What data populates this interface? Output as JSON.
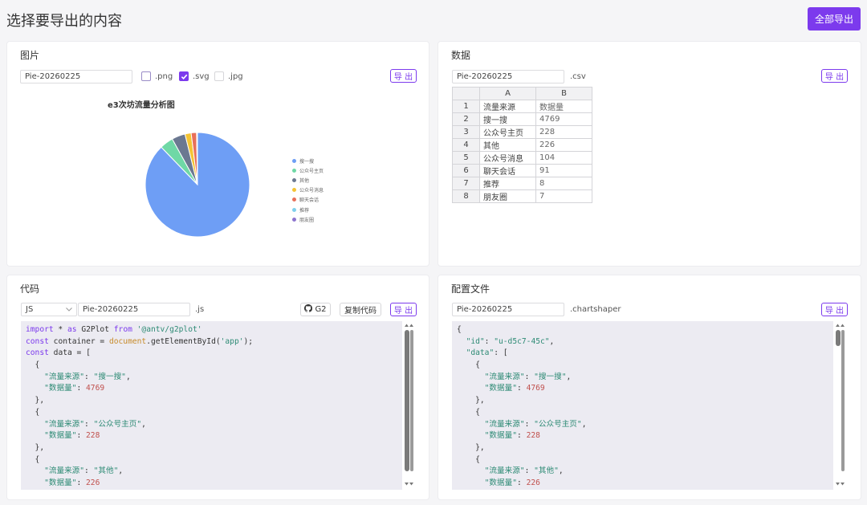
{
  "header": {
    "title": "选择要导出的内容",
    "export_all": "全部导出"
  },
  "image_card": {
    "title": "图片",
    "filename": "Pie-20260225",
    "formats": [
      {
        "label": ".png",
        "checked": false
      },
      {
        "label": ".svg",
        "checked": true
      },
      {
        "label": ".jpg",
        "checked": false
      }
    ],
    "export": "导 出"
  },
  "chart_data": {
    "type": "pie",
    "title": "e3次坊流量分析图",
    "categories": [
      "搜一搜",
      "公众号主页",
      "其他",
      "公众号消息",
      "聊天会话",
      "推荐",
      "朋友圈"
    ],
    "values": [
      4769,
      228,
      226,
      104,
      91,
      8,
      7
    ],
    "colors": [
      "#6e9ef5",
      "#6fd8a6",
      "#6b7891",
      "#f4c434",
      "#e8705a",
      "#7fd0ec",
      "#8d75cf"
    ],
    "legend_position": "right"
  },
  "data_card": {
    "title": "数据",
    "filename": "Pie-20260225",
    "ext": ".csv",
    "export": "导 出",
    "columns": [
      "A",
      "B"
    ],
    "rows": [
      [
        "1",
        "流量来源",
        "数据量"
      ],
      [
        "2",
        "搜一搜",
        "4769"
      ],
      [
        "3",
        "公众号主页",
        "228"
      ],
      [
        "4",
        "其他",
        "226"
      ],
      [
        "5",
        "公众号消息",
        "104"
      ],
      [
        "6",
        "聊天会话",
        "91"
      ],
      [
        "7",
        "推荐",
        "8"
      ],
      [
        "8",
        "朋友圈",
        "7"
      ]
    ]
  },
  "code_card": {
    "title": "代码",
    "language": "JS",
    "filename": "Pie-20260225",
    "ext": ".js",
    "g2_label": "G2",
    "copy_label": "复制代码",
    "export": "导 出",
    "lines": [
      "import * as G2Plot from '@antv/g2plot'",
      "const container = document.getElementById('app');",
      "const data = [",
      "  {",
      "    \"流量来源\": \"搜一搜\",",
      "    \"数据量\": 4769",
      "  },",
      "  {",
      "    \"流量来源\": \"公众号主页\",",
      "    \"数据量\": 228",
      "  },",
      "  {",
      "    \"流量来源\": \"其他\",",
      "    \"数据量\": 226"
    ]
  },
  "config_card": {
    "title": "配置文件",
    "filename": "Pie-20260225",
    "ext": ".chartshaper",
    "export": "导 出",
    "lines": [
      "{",
      "  \"id\": \"u-d5c7-45c\",",
      "  \"data\": [",
      "    {",
      "      \"流量来源\": \"搜一搜\",",
      "      \"数据量\": 4769",
      "    },",
      "    {",
      "      \"流量来源\": \"公众号主页\",",
      "      \"数据量\": 228",
      "    },",
      "    {",
      "      \"流量来源\": \"其他\",",
      "      \"数据量\": 226"
    ]
  }
}
